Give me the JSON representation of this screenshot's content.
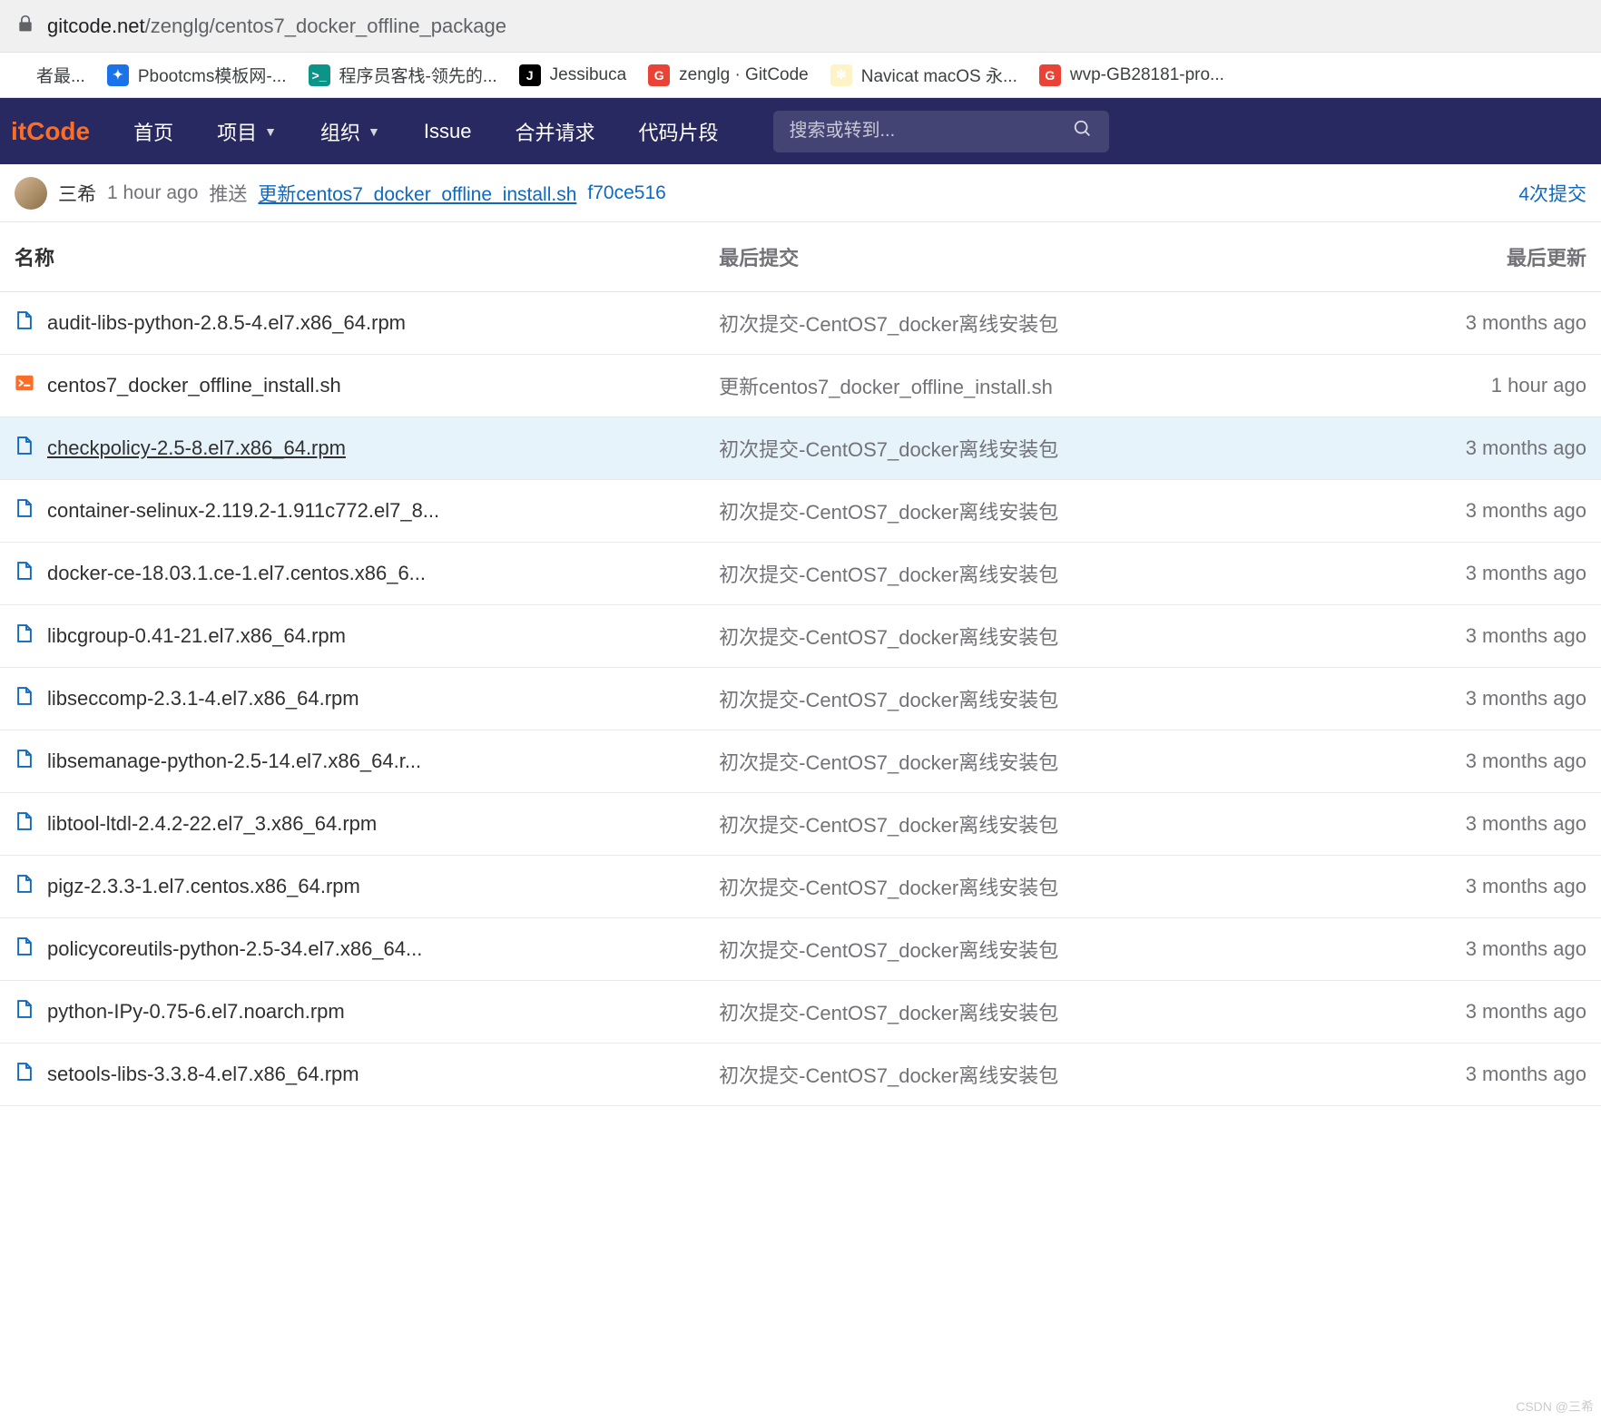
{
  "url": {
    "domain": "gitcode.net",
    "path": "/zenglg/centos7_docker_offline_package"
  },
  "bookmarks": [
    {
      "label": "者最...",
      "icon_bg": "#fff",
      "icon_char": ""
    },
    {
      "label": "Pbootcms模板网-...",
      "icon_bg": "#1a73e8",
      "icon_char": "✦"
    },
    {
      "label": "程序员客栈-领先的...",
      "icon_bg": "#0d9488",
      "icon_char": ">_"
    },
    {
      "label": "Jessibuca",
      "icon_bg": "#000",
      "icon_char": "J"
    },
    {
      "label": "zenglg · GitCode",
      "icon_bg": "#ea4335",
      "icon_char": "G"
    },
    {
      "label": "Navicat macOS 永...",
      "icon_bg": "#fef3c7",
      "icon_char": "✻"
    },
    {
      "label": "wvp-GB28181-pro...",
      "icon_bg": "#ea4335",
      "icon_char": "G"
    }
  ],
  "nav": {
    "logo": "itCode",
    "items": [
      {
        "label": "首页",
        "dropdown": false
      },
      {
        "label": "项目",
        "dropdown": true
      },
      {
        "label": "组织",
        "dropdown": true
      },
      {
        "label": "Issue",
        "dropdown": false
      },
      {
        "label": "合并请求",
        "dropdown": false
      },
      {
        "label": "代码片段",
        "dropdown": false
      }
    ],
    "search_placeholder": "搜索或转到..."
  },
  "commit": {
    "author": "三希",
    "time": "1 hour ago",
    "action": "推送",
    "link_text": "更新centos7_docker_offline_install.sh",
    "sha": "f70ce516",
    "count_link": "4次提交"
  },
  "headers": {
    "name": "名称",
    "commit": "最后提交",
    "updated": "最后更新"
  },
  "files": [
    {
      "name": "audit-libs-python-2.8.5-4.el7.x86_64.rpm",
      "commit": "初次提交-CentOS7_docker离线安装包",
      "updated": "3 months ago",
      "type": "file"
    },
    {
      "name": "centos7_docker_offline_install.sh",
      "commit": "更新centos7_docker_offline_install.sh",
      "updated": "1 hour ago",
      "type": "sh"
    },
    {
      "name": "checkpolicy-2.5-8.el7.x86_64.rpm",
      "commit": "初次提交-CentOS7_docker离线安装包",
      "updated": "3 months ago",
      "type": "file",
      "hover": true
    },
    {
      "name": "container-selinux-2.119.2-1.911c772.el7_8...",
      "commit": "初次提交-CentOS7_docker离线安装包",
      "updated": "3 months ago",
      "type": "file"
    },
    {
      "name": "docker-ce-18.03.1.ce-1.el7.centos.x86_6...",
      "commit": "初次提交-CentOS7_docker离线安装包",
      "updated": "3 months ago",
      "type": "file"
    },
    {
      "name": "libcgroup-0.41-21.el7.x86_64.rpm",
      "commit": "初次提交-CentOS7_docker离线安装包",
      "updated": "3 months ago",
      "type": "file"
    },
    {
      "name": "libseccomp-2.3.1-4.el7.x86_64.rpm",
      "commit": "初次提交-CentOS7_docker离线安装包",
      "updated": "3 months ago",
      "type": "file"
    },
    {
      "name": "libsemanage-python-2.5-14.el7.x86_64.r...",
      "commit": "初次提交-CentOS7_docker离线安装包",
      "updated": "3 months ago",
      "type": "file"
    },
    {
      "name": "libtool-ltdl-2.4.2-22.el7_3.x86_64.rpm",
      "commit": "初次提交-CentOS7_docker离线安装包",
      "updated": "3 months ago",
      "type": "file"
    },
    {
      "name": "pigz-2.3.3-1.el7.centos.x86_64.rpm",
      "commit": "初次提交-CentOS7_docker离线安装包",
      "updated": "3 months ago",
      "type": "file"
    },
    {
      "name": "policycoreutils-python-2.5-34.el7.x86_64...",
      "commit": "初次提交-CentOS7_docker离线安装包",
      "updated": "3 months ago",
      "type": "file"
    },
    {
      "name": "python-IPy-0.75-6.el7.noarch.rpm",
      "commit": "初次提交-CentOS7_docker离线安装包",
      "updated": "3 months ago",
      "type": "file"
    },
    {
      "name": "setools-libs-3.3.8-4.el7.x86_64.rpm",
      "commit": "初次提交-CentOS7_docker离线安装包",
      "updated": "3 months ago",
      "type": "file"
    }
  ],
  "watermark": "CSDN @三希"
}
